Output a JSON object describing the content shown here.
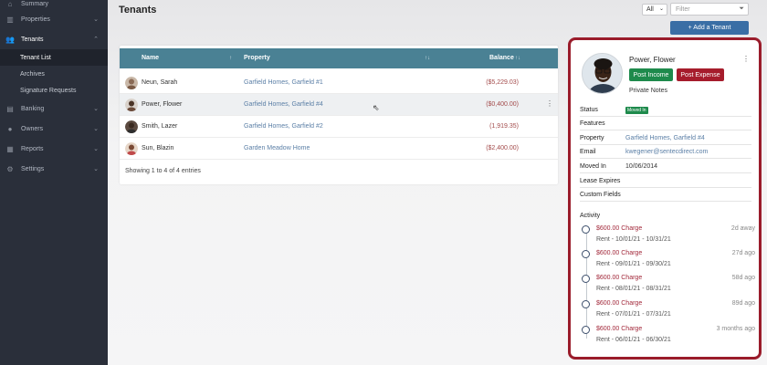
{
  "sidebar": {
    "items": [
      {
        "label": "Summary",
        "icon": "home-icon"
      },
      {
        "label": "Properties",
        "icon": "building-icon"
      },
      {
        "label": "Tenants",
        "icon": "users-icon"
      },
      {
        "label": "Banking",
        "icon": "bank-icon"
      },
      {
        "label": "Owners",
        "icon": "user-icon"
      },
      {
        "label": "Reports",
        "icon": "chart-icon"
      },
      {
        "label": "Settings",
        "icon": "gear-icon"
      }
    ],
    "tenant_sub": [
      "Tenant List",
      "Archives",
      "Signature Requests"
    ]
  },
  "page": {
    "title": "Tenants",
    "all_filter": "All",
    "filter_placeholder": "Filter",
    "add_tenant": "+ Add a Tenant"
  },
  "table": {
    "columns": [
      "Name",
      "Property",
      "Balance"
    ],
    "rows": [
      {
        "name": "Neun, Sarah",
        "property": "Garfield Homes, Garfield #1",
        "balance": "($5,229.03)"
      },
      {
        "name": "Power, Flower",
        "property": "Garfield Homes, Garfield #4",
        "balance": "($0,400.00)"
      },
      {
        "name": "Smith, Lazer",
        "property": "Garfield Homes, Garfield #2",
        "balance": "(1,919.35)"
      },
      {
        "name": "Sun, Blazin",
        "property": "Garden Meadow Home",
        "balance": "($2,400.00)"
      }
    ],
    "footer": "Showing 1 to 4 of 4 entries"
  },
  "detail": {
    "name": "Power, Flower",
    "post_income": "Post Income",
    "post_expense": "Post Expense",
    "private_notes": "Private Notes",
    "fields": {
      "status_label": "Status",
      "status_value": "Moved In",
      "features_label": "Features",
      "property_label": "Property",
      "property_value": "Garfield Homes, Garfield #4",
      "email_label": "Email",
      "email_value": "kwegener@sentecdirect.com",
      "moved_in_label": "Moved In",
      "moved_in_value": "10/06/2014",
      "lease_expires_label": "Lease Expires",
      "custom_fields_label": "Custom Fields"
    },
    "activity_title": "Activity",
    "activity": [
      {
        "charge": "$600.00 Charge",
        "desc": "Rent - 10/01/21 - 10/31/21",
        "when": "2d away"
      },
      {
        "charge": "$600.00 Charge",
        "desc": "Rent - 09/01/21 - 09/30/21",
        "when": "27d ago"
      },
      {
        "charge": "$600.00 Charge",
        "desc": "Rent - 08/01/21 - 08/31/21",
        "when": "58d ago"
      },
      {
        "charge": "$600.00 Charge",
        "desc": "Rent - 07/01/21 - 07/31/21",
        "when": "89d ago"
      },
      {
        "charge": "$600.00 Charge",
        "desc": "Rent - 06/01/21 - 06/30/21",
        "when": "3 months ago"
      }
    ]
  },
  "colors": {
    "sidebar": "#2a2f3a",
    "table_header": "#4a8194",
    "panel_border": "#9a1c2b",
    "income": "#1e8a4c",
    "expense": "#a61c2c",
    "link": "#5b7fa6"
  }
}
